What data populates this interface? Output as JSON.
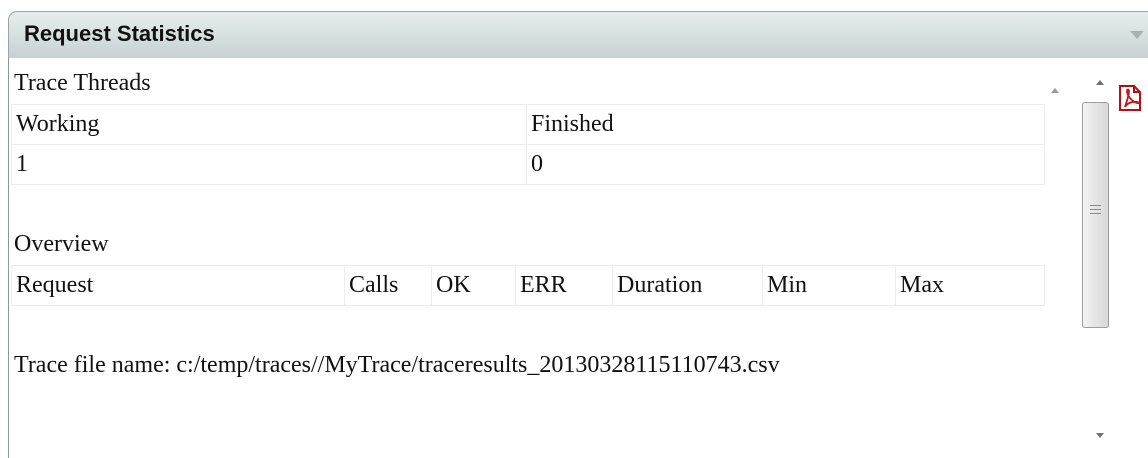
{
  "panel": {
    "title": "Request Statistics"
  },
  "trace_threads": {
    "label": "Trace Threads",
    "headers": [
      "Working",
      "Finished"
    ],
    "values": [
      "1",
      "0"
    ]
  },
  "overview": {
    "label": "Overview",
    "headers": [
      "Request",
      "Calls",
      "OK",
      "ERR",
      "Duration",
      "Min",
      "Max"
    ]
  },
  "trace_file": {
    "text": "Trace file name: c:/temp/traces//MyTrace/traceresults_20130328115110743.csv"
  },
  "icons": {
    "collapse": "chevron-down-icon",
    "export": "pdf-icon",
    "scroll_up": "arrow-up-icon",
    "scroll_down": "arrow-down-icon"
  }
}
